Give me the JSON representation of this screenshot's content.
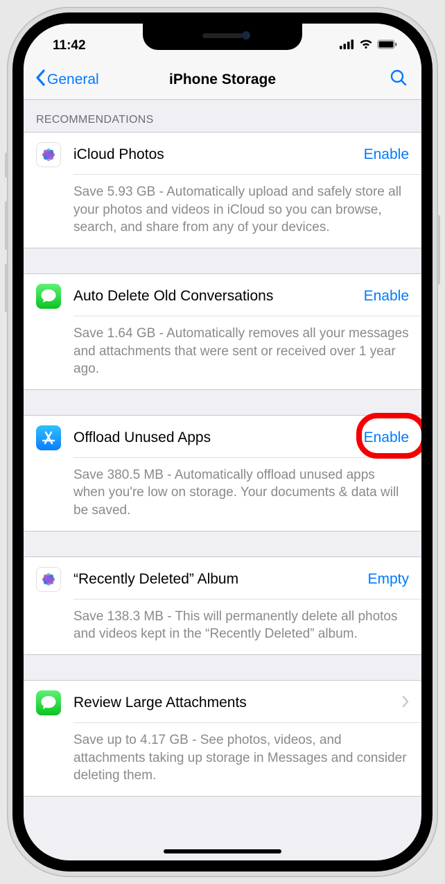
{
  "status": {
    "time": "11:42"
  },
  "nav": {
    "back_label": "General",
    "title": "iPhone Storage"
  },
  "section_header": "Recommendations",
  "items": [
    {
      "icon": "photos",
      "title": "iCloud Photos",
      "action": "Enable",
      "desc": "Save 5.93 GB - Automatically upload and safely store all your photos and videos in iCloud so you can browse, search, and share from any of your devices."
    },
    {
      "icon": "messages",
      "title": "Auto Delete Old Conversations",
      "action": "Enable",
      "desc": "Save 1.64 GB - Automatically removes all your messages and attachments that were sent or received over 1 year ago."
    },
    {
      "icon": "appstore",
      "title": "Offload Unused Apps",
      "action": "Enable",
      "desc": "Save 380.5 MB - Automatically offload unused apps when you're low on storage. Your documents & data will be saved."
    },
    {
      "icon": "photos",
      "title": "“Recently Deleted” Album",
      "action": "Empty",
      "desc": "Save 138.3 MB - This will permanently delete all photos and videos kept in the “Recently Deleted” album."
    },
    {
      "icon": "messages",
      "title": "Review Large Attachments",
      "action": "chevron",
      "desc": "Save up to 4.17 GB - See photos, videos, and attachments taking up storage in Messages and consider deleting them."
    }
  ]
}
